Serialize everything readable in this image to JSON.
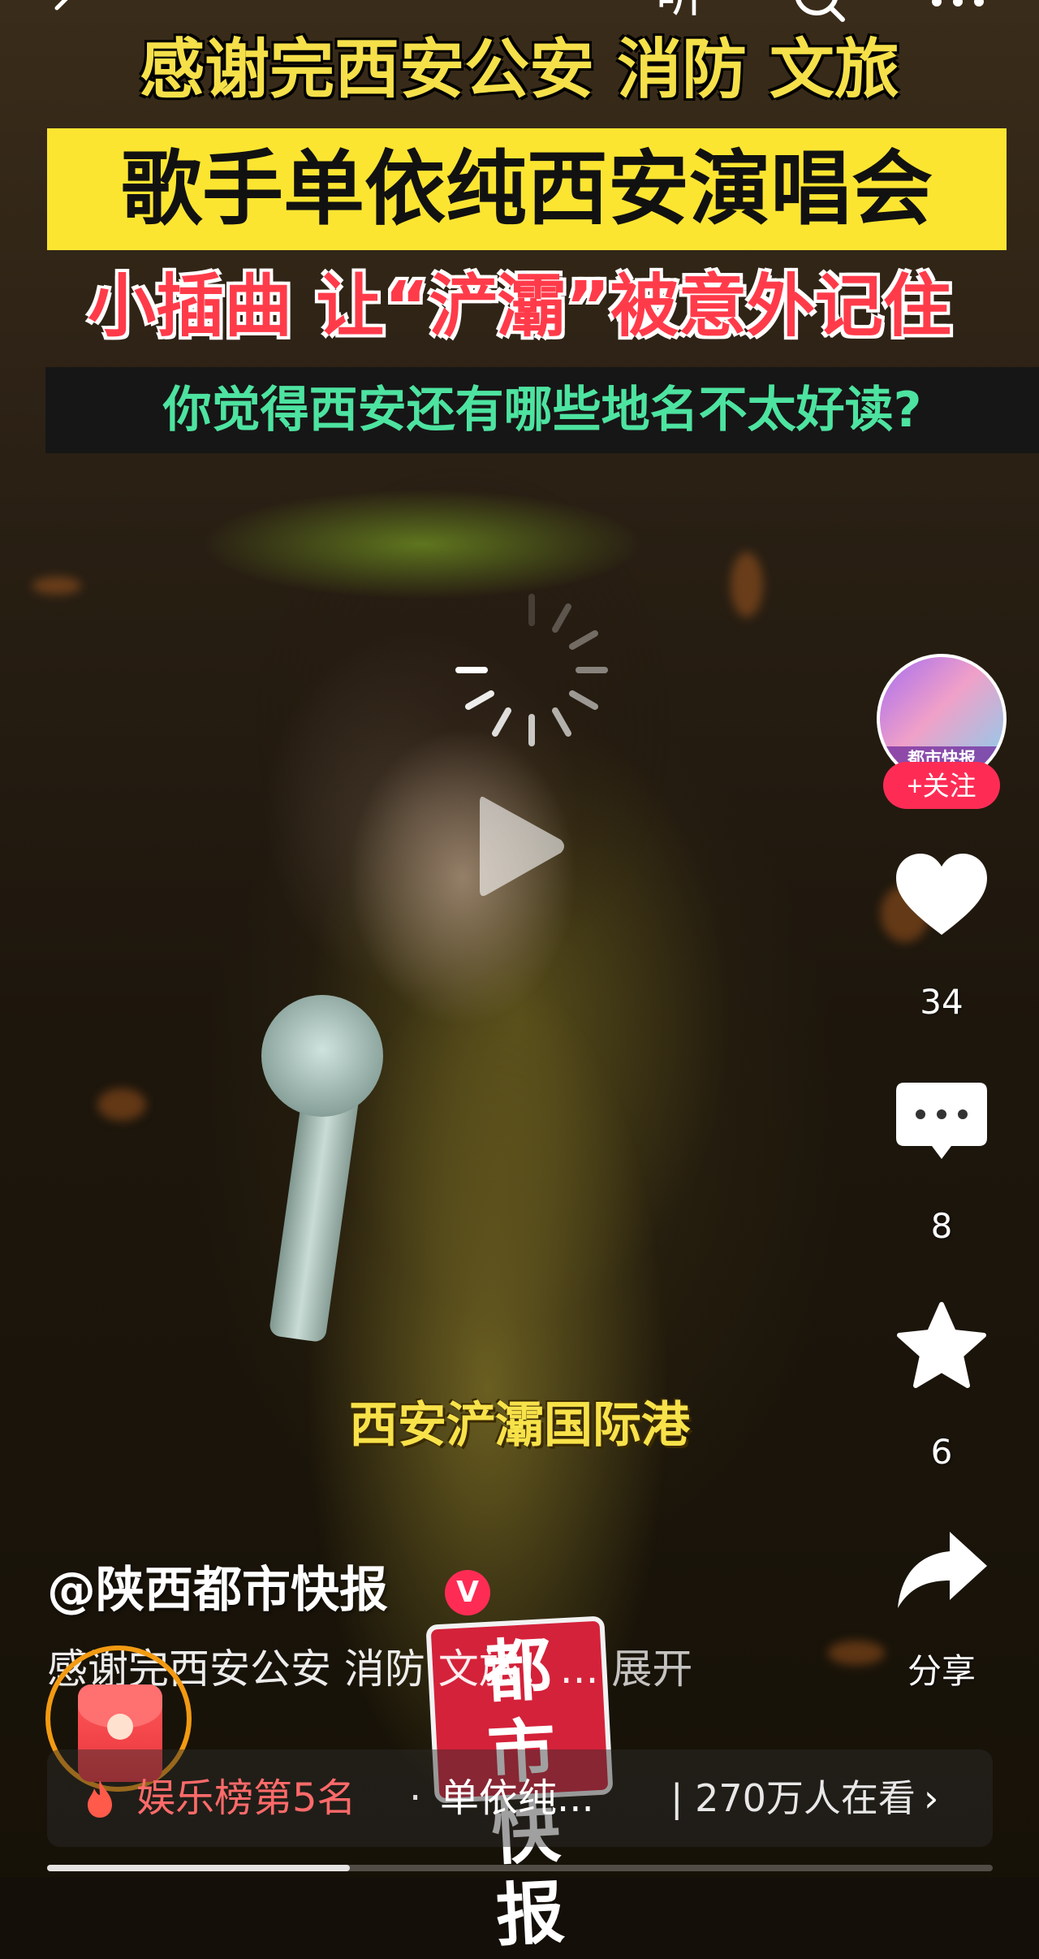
{
  "video": {
    "caption_line1": "感谢完西安公安 消防 文旅",
    "caption_line2": "歌手单依纯西安演唱会",
    "caption_line3": "小插曲 让“浐灞”被意外记住",
    "caption_line4": "你觉得西安还有哪些地名不太好读?",
    "subtitle": "西安浐灞国际港",
    "watermark_logo": "都市快报"
  },
  "topbar": {
    "back_icon": "chevron-left-icon",
    "listen_label": "听",
    "search_icon": "search-icon",
    "more_icon": "more-icon"
  },
  "sidebar": {
    "avatar_label": "都市快报",
    "follow_label": "+关注",
    "like_count": "34",
    "comment_count": "8",
    "favorite_count": "6",
    "share_label": "分享"
  },
  "post": {
    "author": "@陕西都市快报",
    "verified_badge": "V",
    "description": "感谢完西安公安 消防 文旅！...",
    "expand_label": "展开"
  },
  "hot_bar": {
    "rank_label": "娱乐榜第5名",
    "separator": "·",
    "topic": "单依纯...",
    "viewers": "| 270万人在看",
    "chevron": "›"
  },
  "progress": {
    "fraction": 0.32
  },
  "colors": {
    "accent": "#fe2c55",
    "caption_yellow": "#f5e04a",
    "caption_red": "#ff3b4a",
    "caption_green": "#4de3a0",
    "red_packet_ring": "#f29a12"
  }
}
